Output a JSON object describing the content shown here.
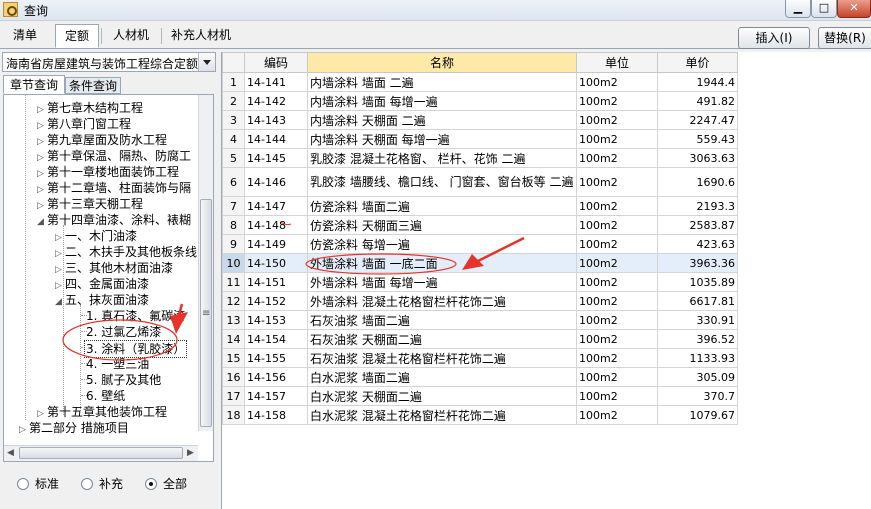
{
  "window": {
    "title": "查询"
  },
  "top_tabs": [
    "清单",
    "定额",
    "人材机",
    "补充人材机"
  ],
  "buttons": {
    "insert": "插入(I)",
    "replace": "替换(R)"
  },
  "quota_library": "海南省房屋建筑与装饰工程综合定额",
  "sub_tabs": [
    "章节查询",
    "条件查询"
  ],
  "tree": [
    "第七章木结构工程",
    "第八章门窗工程",
    "第九章屋面及防水工程",
    "第十章保温、隔热、防腐工",
    "第十一章楼地面装饰工程",
    "第十二章墙、柱面装饰与隔",
    "第十三章天棚工程",
    "第十四章油漆、涂料、裱糊",
    "一、木门油漆",
    "二、木扶手及其他板条线",
    "三、其他木材面油漆",
    "四、金属面油漆",
    "五、抹灰面油漆",
    "1. 真石漆、氟碳漆",
    "2. 过氯乙烯漆",
    "3. 涂料（乳胶漆）",
    "4. 一塑三油",
    "5. 腻子及其他",
    "6. 壁纸",
    "第十五章其他装饰工程",
    "第二部分 措施项目"
  ],
  "filter_options": [
    "标准",
    "补充",
    "全部"
  ],
  "filter_selected": "全部",
  "table": {
    "columns": [
      "编码",
      "名称",
      "单位",
      "单价"
    ],
    "rows": [
      {
        "n": "1",
        "code": "14-141",
        "name": "内墙涂料 墙面 二遍",
        "unit": "100m2",
        "price": "1944.4"
      },
      {
        "n": "2",
        "code": "14-142",
        "name": "内墙涂料 墙面 每增一遍",
        "unit": "100m2",
        "price": "491.82"
      },
      {
        "n": "3",
        "code": "14-143",
        "name": "内墙涂料 天棚面 二遍",
        "unit": "100m2",
        "price": "2247.47"
      },
      {
        "n": "4",
        "code": "14-144",
        "name": "内墙涂料 天棚面 每增一遍",
        "unit": "100m2",
        "price": "559.43"
      },
      {
        "n": "5",
        "code": "14-145",
        "name": "乳胶漆 混凝土花格窗、 栏杆、花饰 二遍",
        "unit": "100m2",
        "price": "3063.63"
      },
      {
        "n": "6",
        "code": "14-146",
        "name": "乳胶漆 墙腰线、檐口线、 门窗套、窗台板等 二遍",
        "unit": "100m2",
        "price": "1690.6"
      },
      {
        "n": "7",
        "code": "14-147",
        "name": "仿瓷涂料 墙面二遍",
        "unit": "100m2",
        "price": "2193.3"
      },
      {
        "n": "8",
        "code": "14-148",
        "name": "仿瓷涂料 天棚面三遍",
        "unit": "100m2",
        "price": "2583.87"
      },
      {
        "n": "9",
        "code": "14-149",
        "name": "仿瓷涂料 每增一遍",
        "unit": "100m2",
        "price": "423.63"
      },
      {
        "n": "10",
        "code": "14-150",
        "name": "外墙涂料 墙面 一底二面",
        "unit": "100m2",
        "price": "3963.36"
      },
      {
        "n": "11",
        "code": "14-151",
        "name": "外墙涂料 墙面 每增一遍",
        "unit": "100m2",
        "price": "1035.89"
      },
      {
        "n": "12",
        "code": "14-152",
        "name": "外墙涂料 混凝土花格窗栏杆花饰二遍",
        "unit": "100m2",
        "price": "6617.81"
      },
      {
        "n": "13",
        "code": "14-153",
        "name": "石灰油浆 墙面二遍",
        "unit": "100m2",
        "price": "330.91"
      },
      {
        "n": "14",
        "code": "14-154",
        "name": "石灰油浆 天棚面二遍",
        "unit": "100m2",
        "price": "396.52"
      },
      {
        "n": "15",
        "code": "14-155",
        "name": "石灰油浆 混凝土花格窗栏杆花饰二遍",
        "unit": "100m2",
        "price": "1133.93"
      },
      {
        "n": "16",
        "code": "14-156",
        "name": "白水泥浆 墙面二遍",
        "unit": "100m2",
        "price": "305.09"
      },
      {
        "n": "17",
        "code": "14-157",
        "name": "白水泥浆 天棚面二遍",
        "unit": "100m2",
        "price": "370.7"
      },
      {
        "n": "18",
        "code": "14-158",
        "name": "白水泥浆 混凝土花格窗栏杆花饰二遍",
        "unit": "100m2",
        "price": "1079.67"
      }
    ]
  },
  "colors": {
    "annotation": "#e8332a",
    "header_highlight": "#ffe9a8",
    "selected_row": "#e3eefa"
  }
}
